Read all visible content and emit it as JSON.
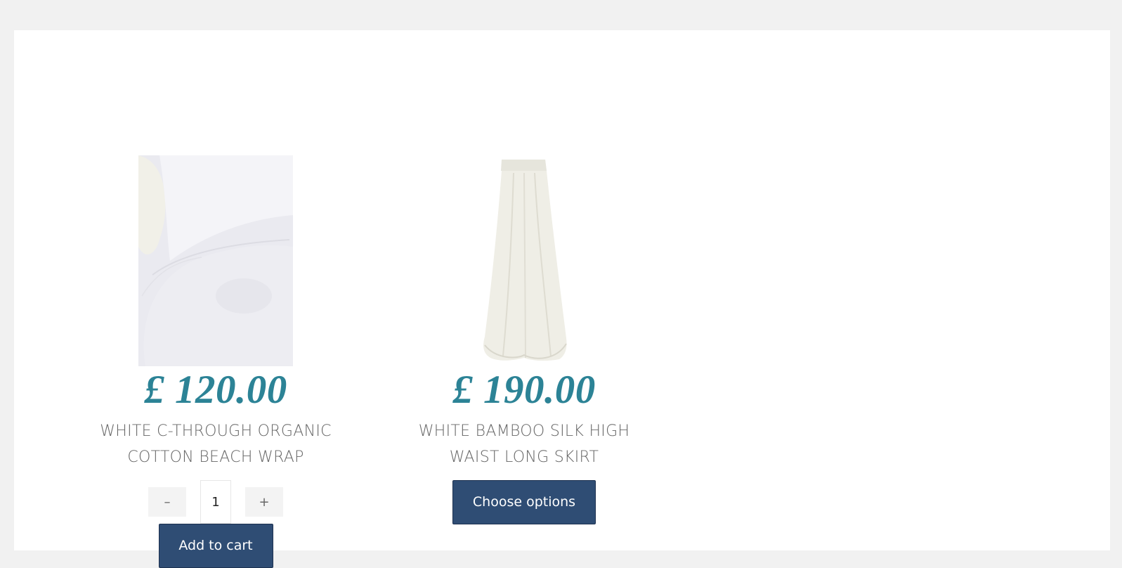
{
  "products": [
    {
      "price": "£ 120.00",
      "title_line1": "WHITE C-THROUGH ORGANIC",
      "title_line2": "COTTON BEACH WRAP",
      "quantity": "1",
      "minus_label": "–",
      "plus_label": "+",
      "cta_label": "Add to cart"
    },
    {
      "price": "£ 190.00",
      "title_line1": "WHITE BAMBOO SILK HIGH",
      "title_line2": "WAIST LONG SKIRT",
      "cta_label": "Choose options"
    }
  ],
  "colors": {
    "page_background": "#f1f1f1",
    "card_background": "#ffffff",
    "price": "#2c8396",
    "title": "#666666",
    "button": "#2f4d74",
    "button_text": "#ffffff"
  }
}
